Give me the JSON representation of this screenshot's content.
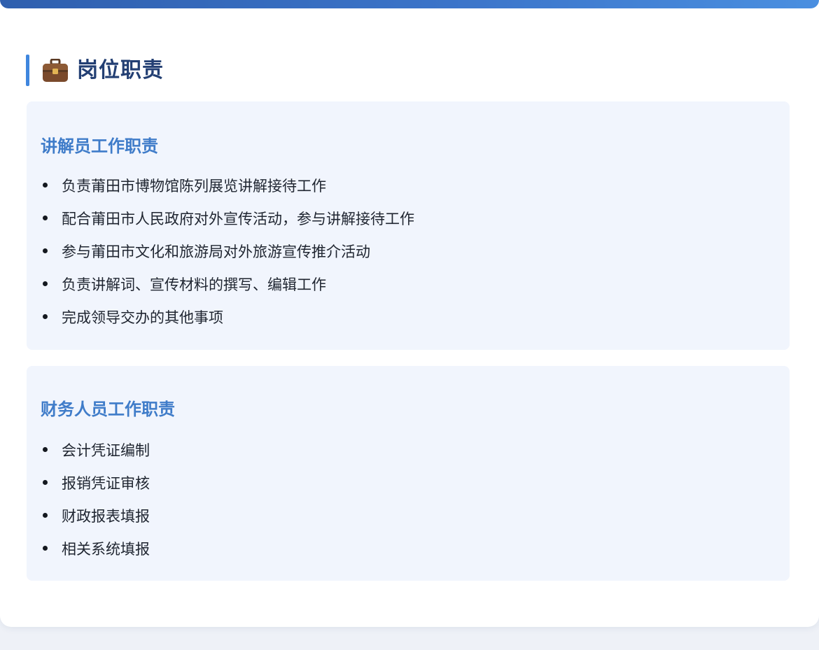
{
  "section": {
    "icon": "briefcase-icon",
    "title": "岗位职责"
  },
  "panels": [
    {
      "title": "讲解员工作职责",
      "items": [
        "负责莆田市博物馆陈列展览讲解接待工作",
        "配合莆田市人民政府对外宣传活动，参与讲解接待工作",
        "参与莆田市文化和旅游局对外旅游宣传推介活动",
        "负责讲解词、宣传材料的撰写、编辑工作",
        "完成领导交办的其他事项"
      ]
    },
    {
      "title": "财务人员工作职责",
      "items": [
        "会计凭证编制",
        "报销凭证审核",
        "财政报表填报",
        "相关系统填报"
      ]
    }
  ],
  "colors": {
    "accent": "#3f86de",
    "heading": "#233f73",
    "panel_title": "#3f7cc9",
    "panel_bg": "#f1f5fd"
  }
}
